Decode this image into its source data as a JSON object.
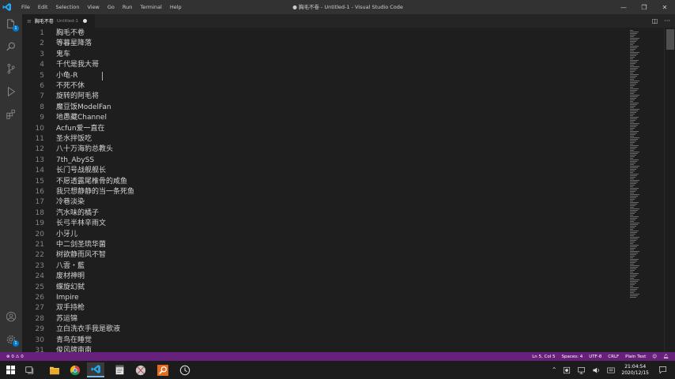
{
  "menu": [
    "File",
    "Edit",
    "Selection",
    "View",
    "Go",
    "Run",
    "Terminal",
    "Help"
  ],
  "window_title": "● 胸毛不卷 - Untitled-1 - Visual Studio Code",
  "tab": {
    "name": "胸毛不卷",
    "description": "Untitled-1"
  },
  "editor_lines": [
    "胸毛不卷",
    "等暮星降落",
    "鬼车",
    "千代是我大哥",
    "小龟-R",
    "不死不休",
    "旋转的阿毛将",
    "魔豆饭ModelFan",
    "地愚藏Channel",
    "Acfun爱一直在",
    "圣水拌饭吃",
    "八十万海豹总教头",
    "7th_AbySS",
    "长门号战舰舰长",
    "不愿透露尾椎骨的咸鱼",
    "我只想静静的当一条死鱼",
    "冷巷淡染",
    "汽水味的橘子",
    "长弓半林辛雨文",
    "小牙儿",
    "中二剑圣琉华菌",
    "树欲静而风不智",
    "八雲・藍",
    "废材神明",
    "蝶旋幻弑",
    "Impire",
    "双手持枪",
    "苏运锦",
    "立白洗衣手我是歌液",
    "青鸟在睡觉",
    "俊风牌南南"
  ],
  "status": {
    "problems": "⊗ 0 ⚠ 0",
    "position": "Ln 5, Col 5",
    "indent": "Spaces: 4",
    "encoding": "UTF-8",
    "eol": "CRLF",
    "language": "Plain Text"
  },
  "clock": {
    "time": "21:04:54",
    "date": "2020/12/15"
  },
  "colors": {
    "statusbar": "#68217a",
    "accent": "#007acc"
  }
}
